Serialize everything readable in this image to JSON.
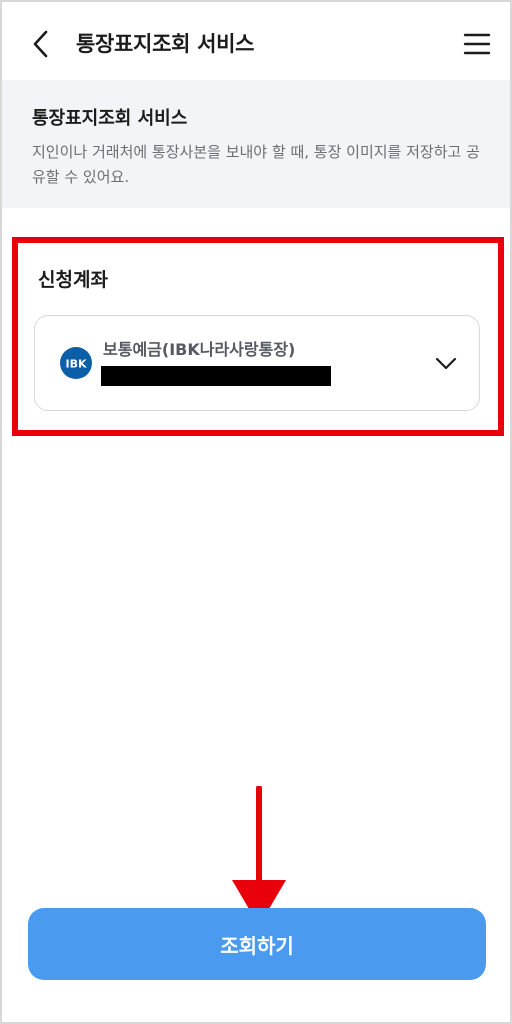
{
  "header": {
    "title": "통장표지조회 서비스",
    "back_icon": "chevron-left-icon",
    "menu_icon": "hamburger-menu-icon"
  },
  "intro": {
    "title": "통장표지조회 서비스",
    "description": "지인이나 거래처에 통장사본을 보내야 할 때, 통장 이미지를 저장하고 공유할 수 있어요."
  },
  "account_section": {
    "label": "신청계좌",
    "selected_account": {
      "name": "보통예금(IBK나라사랑통장)",
      "bank_logo": "ibk-logo-icon",
      "number_redacted": true
    },
    "dropdown_icon": "chevron-down-icon"
  },
  "annotation": {
    "highlight_color": "#e8000b",
    "arrow_color": "#e8000b"
  },
  "submit": {
    "label": "조회하기",
    "color": "#4a9bf0"
  }
}
